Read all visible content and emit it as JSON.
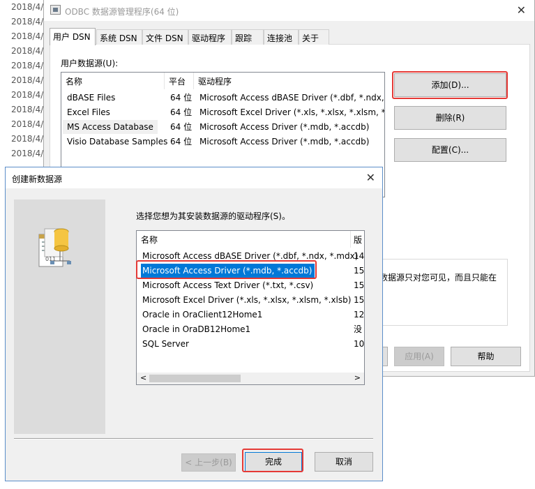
{
  "background": {
    "dates": [
      "2018/4/",
      "2018/4/",
      "2018/4/",
      "2018/4/",
      "2018/4/",
      "2018/4/",
      "2018/4/",
      "2018/4/",
      "2018/4/",
      "2018/4/",
      "2018/4/"
    ]
  },
  "odbc": {
    "title": "ODBC 数据源管理程序(64 位)",
    "tabs": [
      "用户 DSN",
      "系统 DSN",
      "文件 DSN",
      "驱动程序",
      "跟踪",
      "连接池",
      "关于"
    ],
    "section_label": "用户数据源(U):",
    "columns": [
      "名称",
      "平台",
      "驱动程序"
    ],
    "rows": [
      {
        "name": "dBASE Files",
        "platform": "64 位",
        "driver": "Microsoft Access dBASE Driver (*.dbf, *.ndx, *"
      },
      {
        "name": "Excel Files",
        "platform": "64 位",
        "driver": "Microsoft Excel Driver (*.xls, *.xlsx, *.xlsm, *.xls"
      },
      {
        "name": "MS Access Database",
        "platform": "64 位",
        "driver": "Microsoft Access Driver (*.mdb, *.accdb)"
      },
      {
        "name": "Visio Database Samples",
        "platform": "64 位",
        "driver": "Microsoft Access Driver (*.mdb, *.accdb)"
      }
    ],
    "buttons": {
      "add": "添加(D)...",
      "remove": "删除(R)",
      "configure": "配置(C)..."
    },
    "info_text": "数据源只对您可见，而且只能在",
    "bottom_buttons": {
      "apply": "应用(A)",
      "help": "帮助"
    }
  },
  "dialog": {
    "title": "创建新数据源",
    "prompt": "选择您想为其安装数据源的驱动程序(S)。",
    "columns": [
      "名称",
      "版"
    ],
    "drivers": [
      {
        "name": "Microsoft Access dBASE Driver (*.dbf, *.ndx, *.mdx)",
        "version": "14"
      },
      {
        "name": "Microsoft Access Driver (*.mdb, *.accdb)",
        "version": "15"
      },
      {
        "name": "Microsoft Access Text Driver (*.txt, *.csv)",
        "version": "15"
      },
      {
        "name": "Microsoft Excel Driver (*.xls, *.xlsx, *.xlsm, *.xlsb)",
        "version": "15"
      },
      {
        "name": "Oracle in OraClient12Home1",
        "version": "12"
      },
      {
        "name": "Oracle in OraDB12Home1",
        "version": "没"
      },
      {
        "name": "SQL Server",
        "version": "10"
      }
    ],
    "selected_index": 1,
    "scroll_left": "<",
    "scroll_right": ">",
    "buttons": {
      "back": "< 上一步(B)",
      "finish": "完成",
      "cancel": "取消"
    }
  },
  "colors": {
    "highlight": "#0078d7",
    "annotation_red": "#e53935",
    "dialog_border": "#5b8ec9"
  },
  "icons": [
    "window-app-icon",
    "close-icon",
    "database-files-icon",
    "scroll-left-icon",
    "scroll-right-icon"
  ]
}
